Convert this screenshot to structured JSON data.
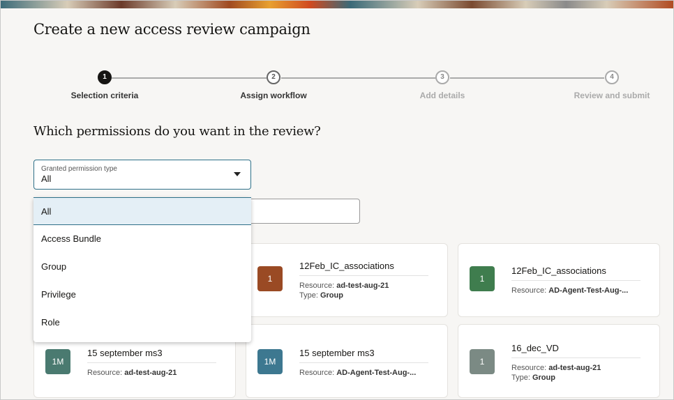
{
  "page": {
    "title": "Create a new access review campaign",
    "question": "Which permissions do you want in the review?"
  },
  "steps": [
    {
      "num": "1",
      "label": "Selection criteria"
    },
    {
      "num": "2",
      "label": "Assign workflow"
    },
    {
      "num": "3",
      "label": "Add details"
    },
    {
      "num": "4",
      "label": "Review and submit"
    }
  ],
  "filter": {
    "label": "Granted permission type",
    "value": "All",
    "options": [
      "All",
      "Access Bundle",
      "Group",
      "Privilege",
      "Role"
    ]
  },
  "colors": {
    "accent": "#2d6f88",
    "selected_bg": "#e4eff6"
  },
  "cards": [
    {
      "badge": "1",
      "title": "12Feb_IC_associations",
      "resource_label": "Resource:",
      "resource": "ad-test-aug-21",
      "type_label": "Type:",
      "type": "Group",
      "color": "#9a4a24"
    },
    {
      "badge": "1",
      "title": "12Feb_IC_associations",
      "resource_label": "Resource:",
      "resource": "AD-Agent-Test-Aug-...",
      "color": "#3f7d4e"
    },
    {
      "badge": "1M",
      "title": "15 september ms3",
      "resource_label": "Resource:",
      "resource": "ad-test-aug-21",
      "color": "#4a7a70"
    },
    {
      "badge": "1M",
      "title": "15 september ms3",
      "resource_label": "Resource:",
      "resource": "AD-Agent-Test-Aug-...",
      "color": "#3d7890"
    },
    {
      "badge": "1",
      "title": "16_dec_VD",
      "resource_label": "Resource:",
      "resource": "ad-test-aug-21",
      "type_label": "Type:",
      "type": "Group",
      "color": "#7b8a84"
    }
  ]
}
